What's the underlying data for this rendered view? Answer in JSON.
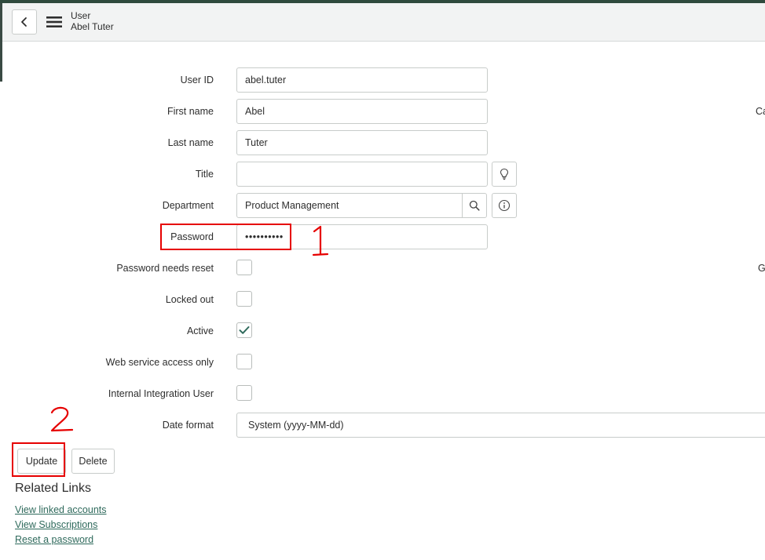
{
  "header": {
    "title": "User",
    "subtitle": "Abel Tuter"
  },
  "form": {
    "user_id": {
      "label": "User ID",
      "value": "abel.tuter"
    },
    "first_name": {
      "label": "First name",
      "value": "Abel"
    },
    "last_name": {
      "label": "Last name",
      "value": "Tuter"
    },
    "title": {
      "label": "Title",
      "value": ""
    },
    "department": {
      "label": "Department",
      "value": "Product Management"
    },
    "password": {
      "label": "Password",
      "value": "••••••••••"
    },
    "password_needs_reset": {
      "label": "Password needs reset",
      "checked": false
    },
    "locked_out": {
      "label": "Locked out",
      "checked": false
    },
    "active": {
      "label": "Active",
      "checked": true
    },
    "web_service_access_only": {
      "label": "Web service access only",
      "checked": false
    },
    "internal_integration_user": {
      "label": "Internal Integration User",
      "checked": false
    },
    "date_format": {
      "label": "Date format",
      "value": "System (yyyy-MM-dd)"
    }
  },
  "right_column": {
    "clipped_label_1": "Ca",
    "clipped_label_2": "G"
  },
  "buttons": {
    "update": "Update",
    "delete": "Delete"
  },
  "related_links": {
    "title": "Related Links",
    "items": [
      "View linked accounts",
      "View Subscriptions",
      "Reset a password"
    ]
  },
  "annotations": {
    "step1": "1",
    "step2": "2",
    "color": "#e60000"
  },
  "colors": {
    "accent": "#2f4a3d",
    "link": "#2f6a5c",
    "check": "#2f6a5c"
  }
}
